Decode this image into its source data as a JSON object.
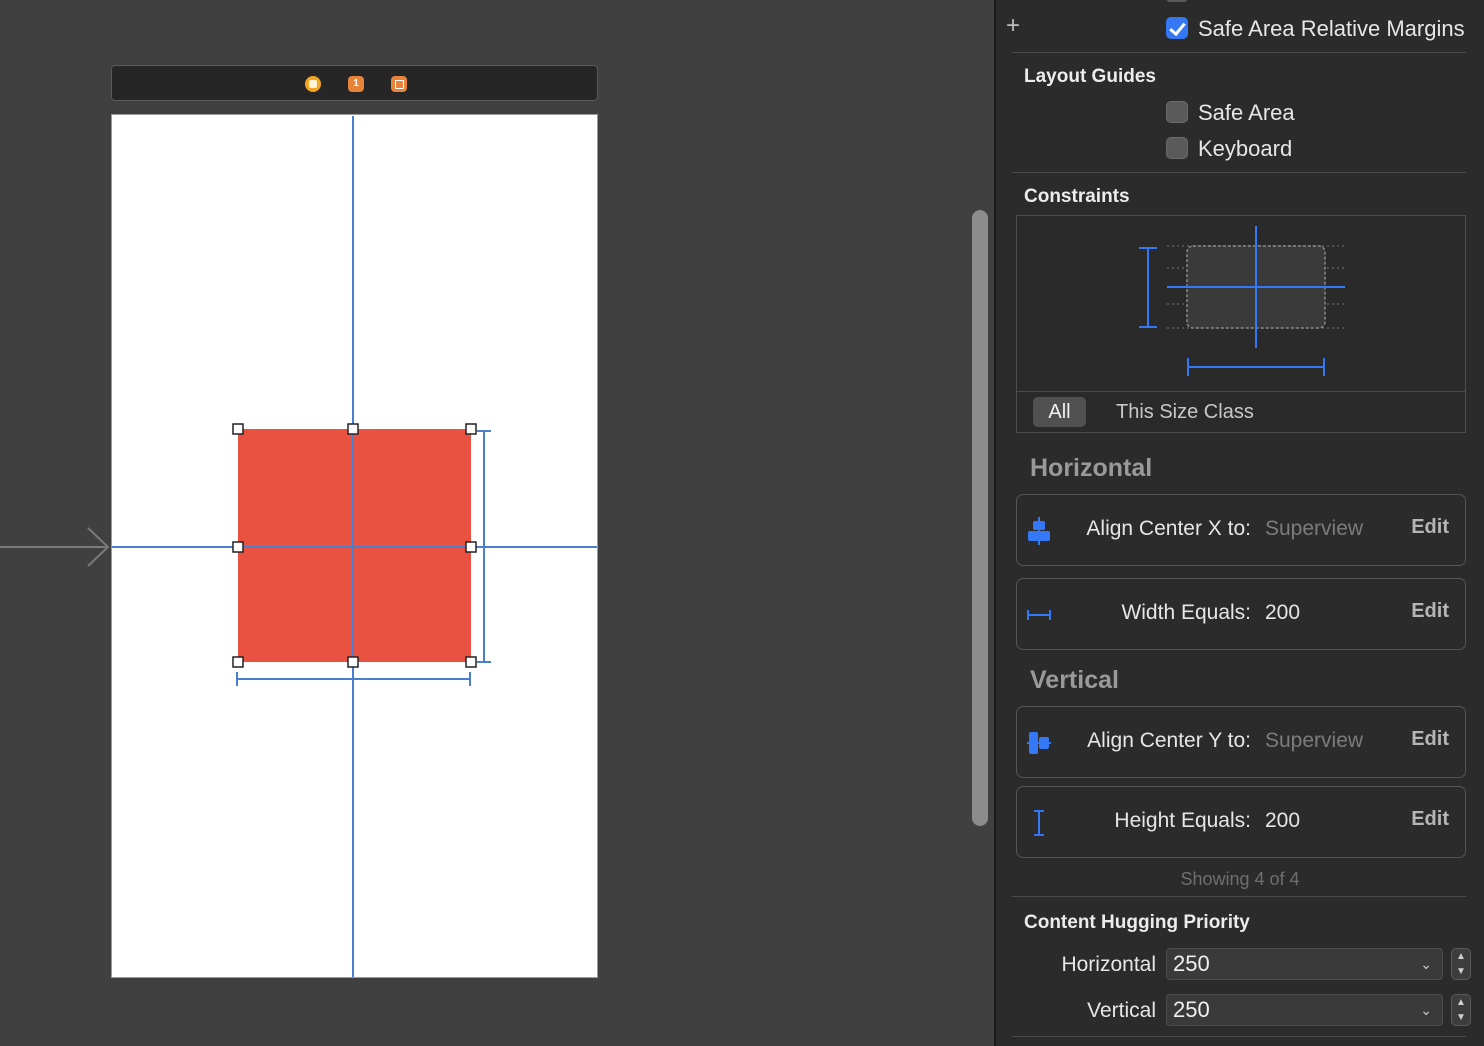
{
  "canvas": {
    "scene_dock": {
      "icons": [
        "view-controller-icon",
        "first-responder-icon",
        "exit-icon"
      ],
      "first_responder_glyph": "1"
    },
    "device": {
      "background": "#ffffff"
    },
    "view": {
      "color": "#e95240"
    }
  },
  "inspector": {
    "safe_area_relative_margins": {
      "label": "Safe Area Relative Margins",
      "checked": true
    },
    "layout_guides": {
      "title": "Layout Guides",
      "safe_area": {
        "label": "Safe Area",
        "checked": false
      },
      "keyboard": {
        "label": "Keyboard",
        "checked": false
      }
    },
    "constraints": {
      "title": "Constraints",
      "segments": [
        "All",
        "This Size Class"
      ],
      "selected_segment": "All"
    },
    "horizontal": {
      "title": "Horizontal",
      "rows": [
        {
          "name": "Align Center X to:",
          "value": "Superview",
          "edit": "Edit",
          "icon": "align-center-x-icon"
        },
        {
          "name": "Width Equals:",
          "value": "200",
          "edit": "Edit",
          "icon": "width-icon"
        }
      ]
    },
    "vertical": {
      "title": "Vertical",
      "rows": [
        {
          "name": "Align Center Y to:",
          "value": "Superview",
          "edit": "Edit",
          "icon": "align-center-y-icon"
        },
        {
          "name": "Height Equals:",
          "value": "200",
          "edit": "Edit",
          "icon": "height-icon"
        }
      ]
    },
    "showing": "Showing 4 of 4",
    "content_hugging": {
      "title": "Content Hugging Priority",
      "horizontal": {
        "label": "Horizontal",
        "value": "250"
      },
      "vertical": {
        "label": "Vertical",
        "value": "250"
      }
    }
  },
  "colors": {
    "accent": "#3478f6",
    "constraint_line": "#4a7fd0",
    "selected_view": "#e95240"
  }
}
